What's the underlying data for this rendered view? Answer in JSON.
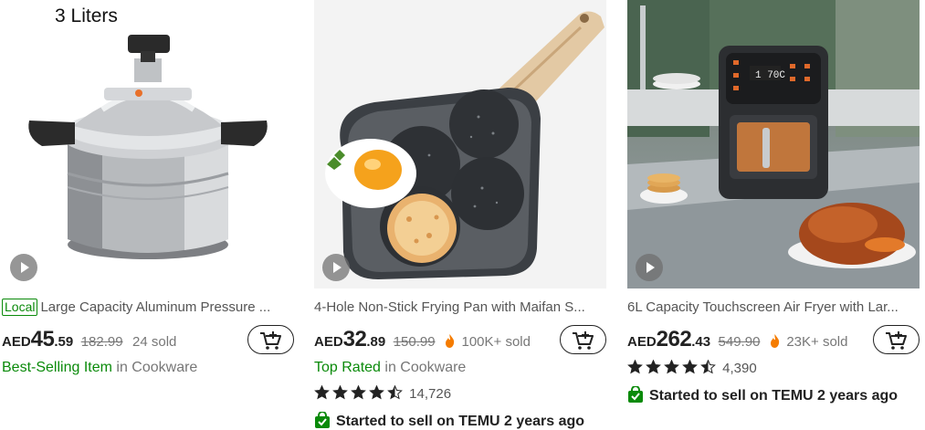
{
  "products": [
    {
      "image_caption": "3 Liters",
      "badge": "Local",
      "title": "Large Capacity Aluminum Pressure ...",
      "currency": "AED",
      "price_int": "45",
      "price_dec": ".59",
      "old_price": "182.99",
      "sold": "24 sold",
      "tag_highlight": "Best-Selling Item",
      "tag_rest": " in Cookware"
    },
    {
      "title": "4-Hole Non-Stick Frying Pan with Maifan S...",
      "currency": "AED",
      "price_int": "32",
      "price_dec": ".89",
      "old_price": "150.99",
      "sold": "100K+ sold",
      "tag_highlight": "Top Rated",
      "tag_rest": " in Cookware",
      "rating": 4.5,
      "reviews": "14,726",
      "seller_note": "Started to sell on TEMU 2 years ago"
    },
    {
      "title": "6L Capacity Touchscreen Air Fryer with Lar...",
      "currency": "AED",
      "price_int": "262",
      "price_dec": ".43",
      "old_price": "549.90",
      "sold": "23K+ sold",
      "rating": 4.5,
      "reviews": "4,390",
      "seller_note": "Started to sell on TEMU 2 years ago"
    }
  ],
  "colors": {
    "accent_green": "#0a8a0a",
    "flame": "#f57c00"
  },
  "icons": [
    "play-icon",
    "add-to-cart-icon",
    "flame-icon",
    "star-icon",
    "shopping-bag-check-icon"
  ]
}
